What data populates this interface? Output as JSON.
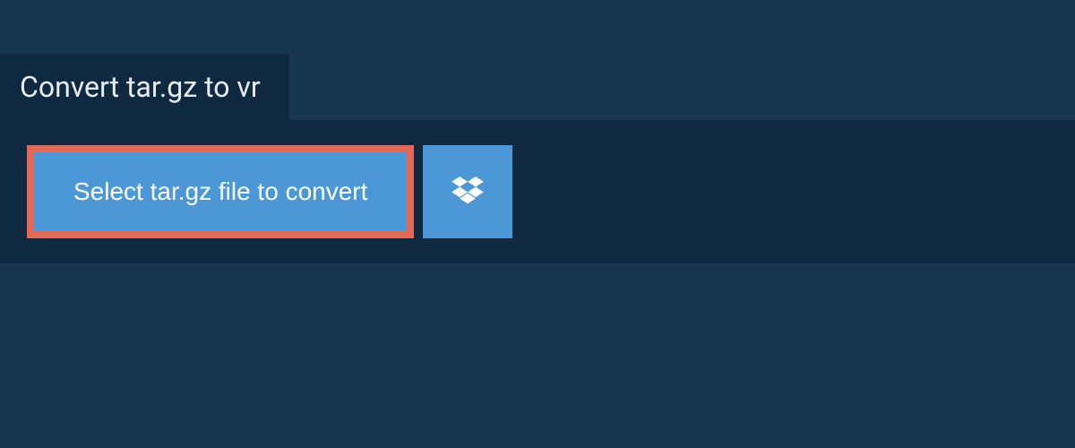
{
  "header": {
    "title": "Convert tar.gz to vr"
  },
  "actions": {
    "select_file_label": "Select tar.gz file to convert"
  },
  "colors": {
    "page_bg": "#17374f",
    "panel_bg": "#0f2a40",
    "button_bg": "#4c97d6",
    "highlight_frame": "#e36957",
    "text_light": "#e8edf2",
    "text_white": "#ffffff"
  }
}
